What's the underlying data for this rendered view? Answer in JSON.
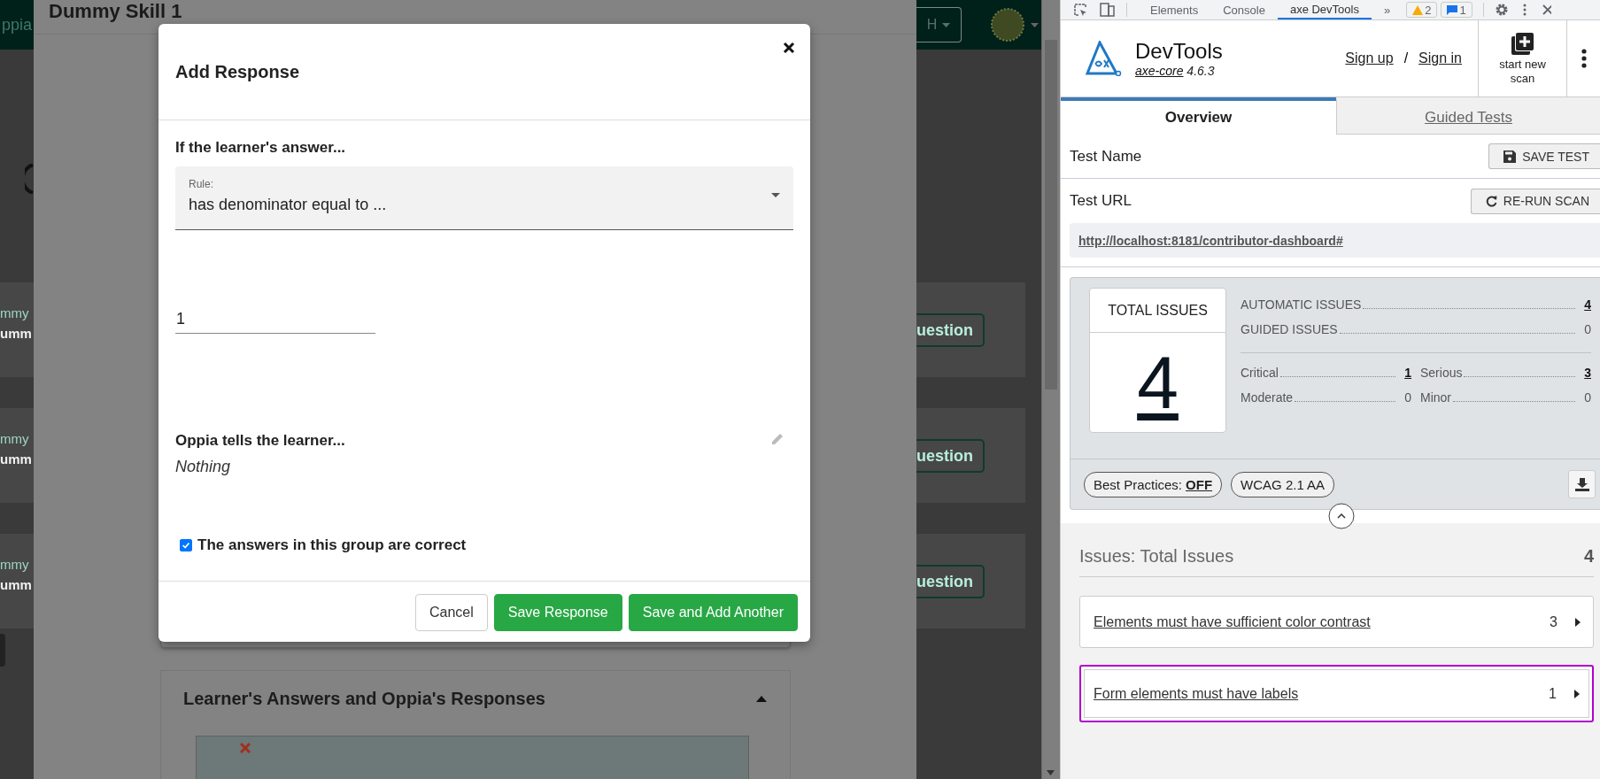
{
  "background_page": {
    "logo": "ppia",
    "language_button": "H",
    "cards": [
      {
        "topic": "mmy",
        "title": "umm",
        "action": "uestion"
      },
      {
        "topic": "mmy",
        "title": "umm",
        "action": "uestion"
      },
      {
        "topic": "mmy",
        "title": "umm",
        "action": "uestion"
      }
    ]
  },
  "skill_panel": {
    "title": "Dummy Skill 1",
    "section": {
      "title": "Learner's Answers and Oppia's Responses",
      "expanded": true
    }
  },
  "modal": {
    "title": "Add Response",
    "rule_heading": "If the learner's answer...",
    "rule": {
      "label": "Rule:",
      "value": "has denominator equal to ..."
    },
    "answer_value": "1",
    "feedback_heading": "Oppia tells the learner...",
    "feedback": "Nothing",
    "correct": {
      "label": "The answers in this group are correct",
      "checked": true
    },
    "buttons": [
      {
        "label": "Cancel",
        "kind": "secondary"
      },
      {
        "label": "Save Response",
        "kind": "primary"
      },
      {
        "label": "Save and Add Another",
        "kind": "primary"
      }
    ]
  },
  "devtools": {
    "tabs": [
      {
        "label": "Elements",
        "selected": false
      },
      {
        "label": "Console",
        "selected": false
      },
      {
        "label": "axe DevTools",
        "selected": true
      }
    ],
    "more": "»",
    "warnings": "2",
    "messages": "1",
    "axe": {
      "title": "DevTools",
      "core_link": "axe-core",
      "version": "4.6.3",
      "sign_up": "Sign up",
      "separator": "/",
      "sign_in": "Sign in",
      "new_scan": "start new scan",
      "tabs": [
        {
          "label": "Overview",
          "selected": true
        },
        {
          "label": "Guided Tests",
          "selected": false
        }
      ],
      "test_name_label": "Test Name",
      "save_button": "SAVE TEST",
      "test_url_label": "Test URL",
      "rerun_button": "RE-RUN SCAN",
      "url": "http://localhost:8181/contributor-dashboard#",
      "summary": {
        "total_label": "TOTAL ISSUES",
        "total": "4",
        "categories": [
          {
            "label": "AUTOMATIC ISSUES",
            "count": "4",
            "linked": true
          },
          {
            "label": "GUIDED ISSUES",
            "count": "0",
            "linked": false
          }
        ],
        "impacts": [
          {
            "label": "Critical",
            "count": "1",
            "linked": true
          },
          {
            "label": "Serious",
            "count": "3",
            "linked": true
          },
          {
            "label": "Moderate",
            "count": "0",
            "linked": false
          },
          {
            "label": "Minor",
            "count": "0",
            "linked": false
          }
        ],
        "best_practices_label": "Best Practices:",
        "best_practices_value": "OFF",
        "standard": "WCAG 2.1 AA"
      },
      "issues_heading": "Issues: Total Issues",
      "issues_count": "4",
      "issues": [
        {
          "title": "Elements must have sufficient color contrast",
          "count": "3",
          "highlighted": false
        },
        {
          "title": "Form elements must have labels",
          "count": "1",
          "highlighted": true
        }
      ]
    }
  }
}
